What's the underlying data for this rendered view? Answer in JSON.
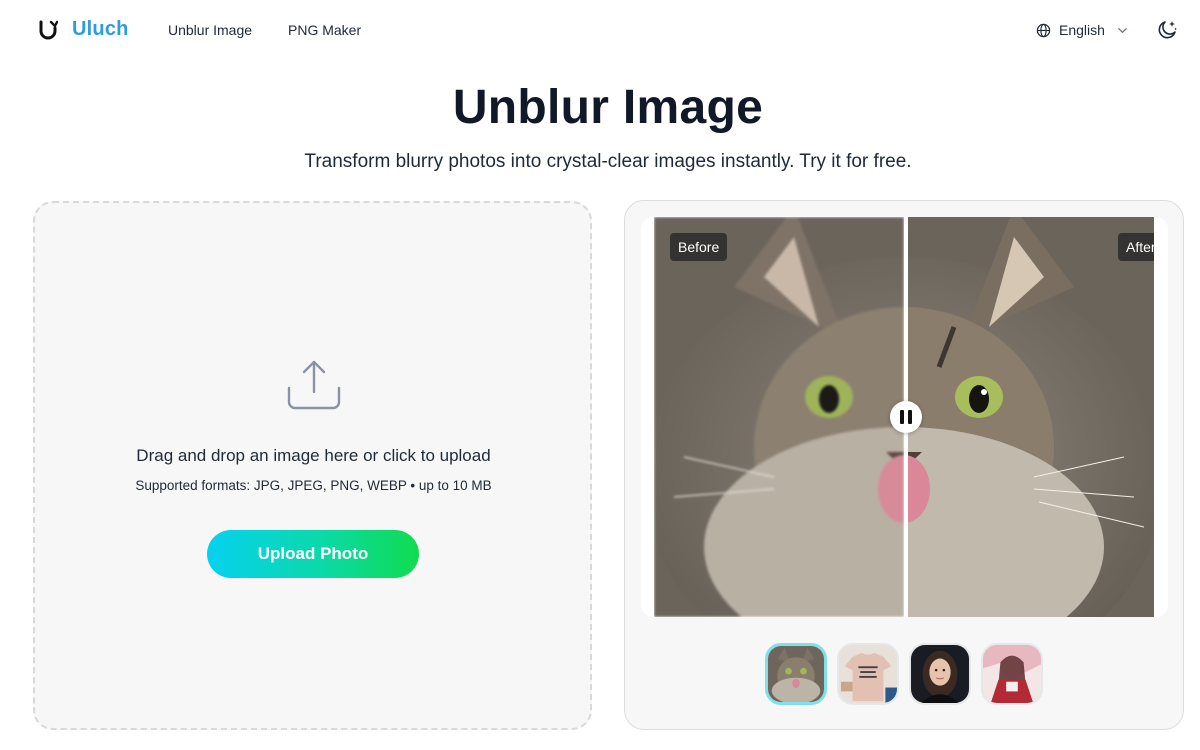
{
  "header": {
    "logo_text": "Uluch",
    "logo_icon": "uluch-logo-icon",
    "nav": [
      {
        "label": "Unblur Image"
      },
      {
        "label": "PNG Maker"
      }
    ],
    "language": {
      "label": "English",
      "icon": "globe-icon"
    },
    "theme_icon": "moon-stars-icon",
    "brand_color": "#2e9be6"
  },
  "hero": {
    "title": "Unblur Image",
    "subtitle": "Transform blurry photos into crystal-clear images instantly. Try it for free."
  },
  "upload": {
    "icon": "upload-icon",
    "main_text": "Drag and drop an image here or click to upload",
    "formats_text": "Supported formats: JPG, JPEG, PNG, WEBP • up to 10 MB",
    "button_label": "Upload Photo",
    "button_gradient": [
      "#06d1f0",
      "#10dc4f"
    ]
  },
  "compare": {
    "before_label": "Before",
    "after_label": "After",
    "handle_icon": "pause-icon",
    "samples": [
      {
        "name": "cat",
        "selected": true
      },
      {
        "name": "t-shirt",
        "selected": false
      },
      {
        "name": "woman-portrait",
        "selected": false
      },
      {
        "name": "anime-girl",
        "selected": false
      }
    ],
    "active_border_color": "#7fe0ea"
  }
}
